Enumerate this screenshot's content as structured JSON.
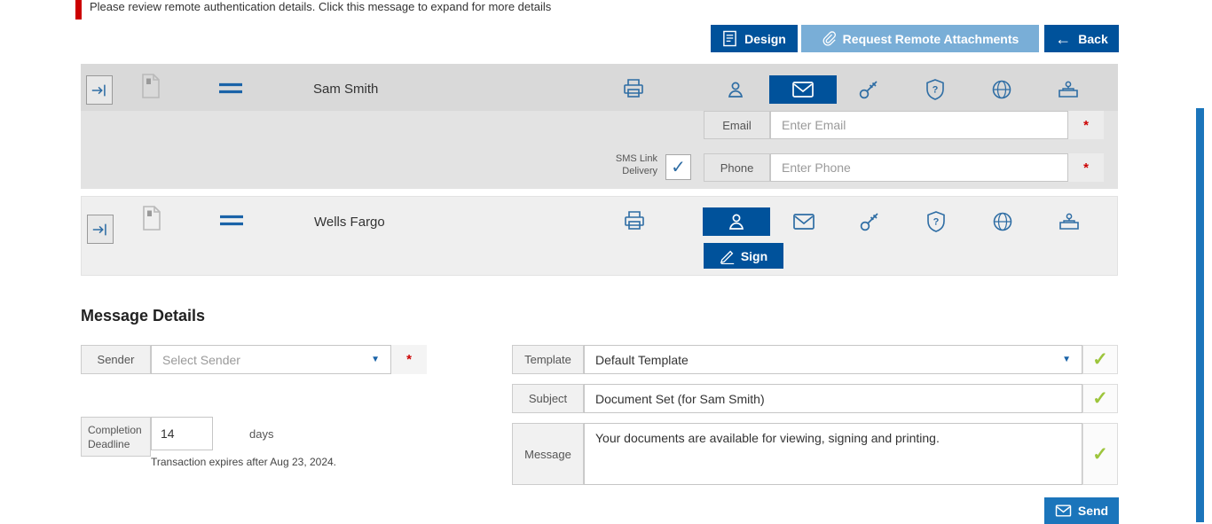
{
  "notice": {
    "text": "Please review remote authentication details. Click this message to expand for more details"
  },
  "toolbar": {
    "design": "Design",
    "request_remote_attachments": "Request Remote Attachments",
    "back": "Back"
  },
  "recipients": {
    "row1": {
      "name": "Sam Smith",
      "email_label": "Email",
      "email_placeholder": "Enter Email",
      "sms_link_delivery": "SMS Link Delivery",
      "phone_label": "Phone",
      "phone_placeholder": "Enter Phone"
    },
    "row2": {
      "name": "Wells Fargo",
      "sign": "Sign"
    }
  },
  "message_details": {
    "title": "Message Details",
    "sender_label": "Sender",
    "sender_placeholder": "Select Sender",
    "completion_deadline_label": "Completion Deadline",
    "deadline_days": "14",
    "days_label": "days",
    "expires_note": "Transaction expires after Aug 23, 2024.",
    "template_label": "Template",
    "template_value": "Default Template",
    "subject_label": "Subject",
    "subject_value": "Document Set (for Sam Smith)",
    "message_label": "Message",
    "message_value": "Your documents are available for viewing, signing and printing.",
    "send": "Send"
  },
  "icons": {
    "check": "✓",
    "caret_down": "▼",
    "back_arrow": "←",
    "asterisk": "*",
    "question_mark": "?"
  },
  "colors": {
    "primary_dark_blue": "#00529b",
    "secondary_blue": "#79aed7",
    "send_blue": "#1b75bb",
    "icon_blue": "#2e6da4",
    "notice_red": "#cc0000",
    "valid_green": "#9dc53c"
  }
}
